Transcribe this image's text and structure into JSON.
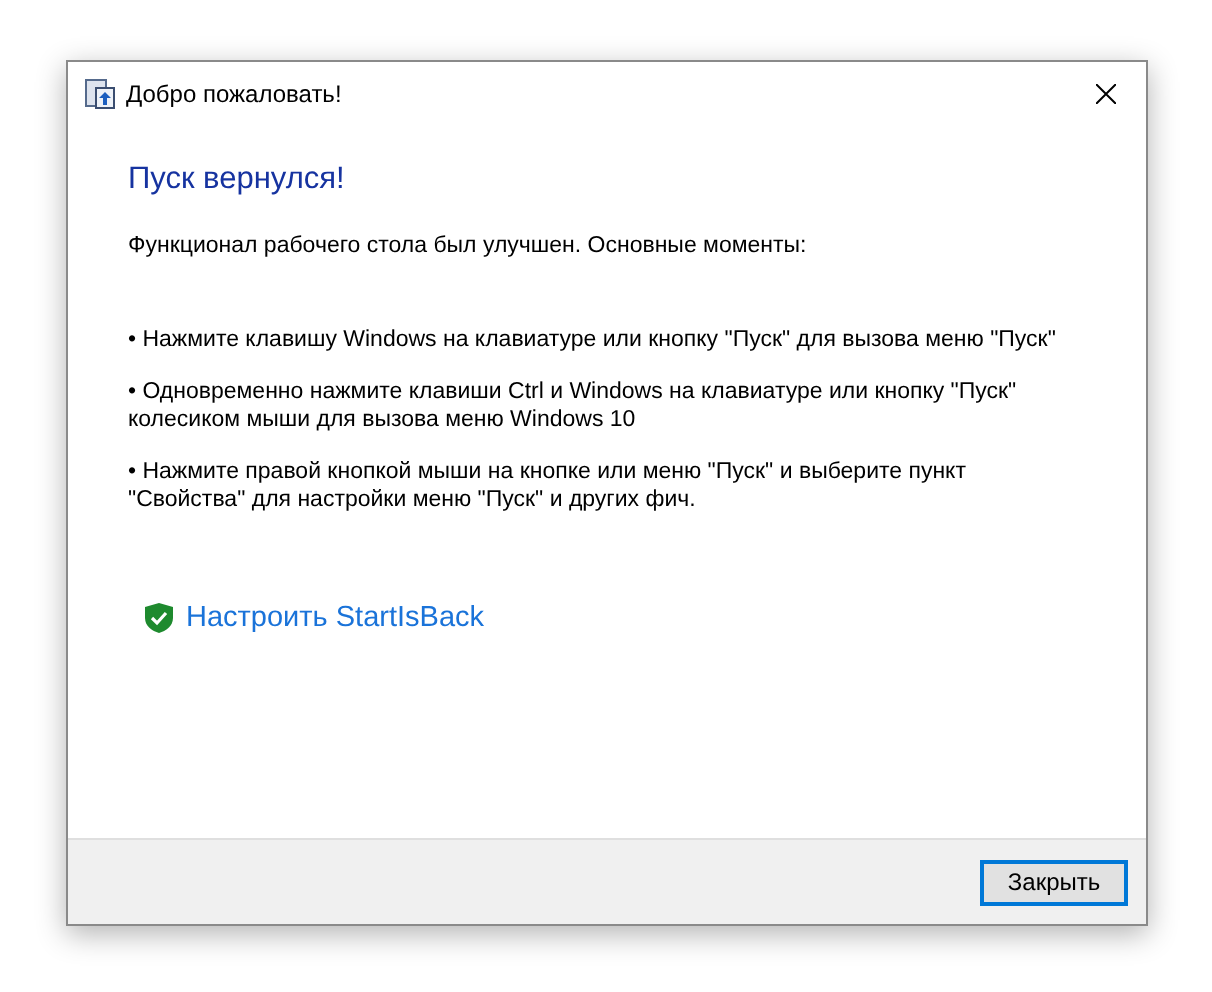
{
  "window": {
    "title": "Добро пожаловать!"
  },
  "heading": "Пуск вернулся!",
  "intro": "Функционал рабочего стола был улучшен. Основные моменты:",
  "bullets": [
    "• Нажмите клавишу Windows на клавиатуре или кнопку \"Пуск\" для вызова меню \"Пуск\"",
    "• Одновременно нажмите клавиши Ctrl и Windows на клавиатуре или кнопку \"Пуск\" колесиком мыши для вызова меню Windows 10",
    "• Нажмите правой кнопкой мыши на кнопке или меню \"Пуск\" и выберите пункт \"Свойства\" для настройки меню \"Пуск\" и других фич."
  ],
  "link": "Настроить StartIsBack",
  "buttons": [
    "Закрыть"
  ]
}
